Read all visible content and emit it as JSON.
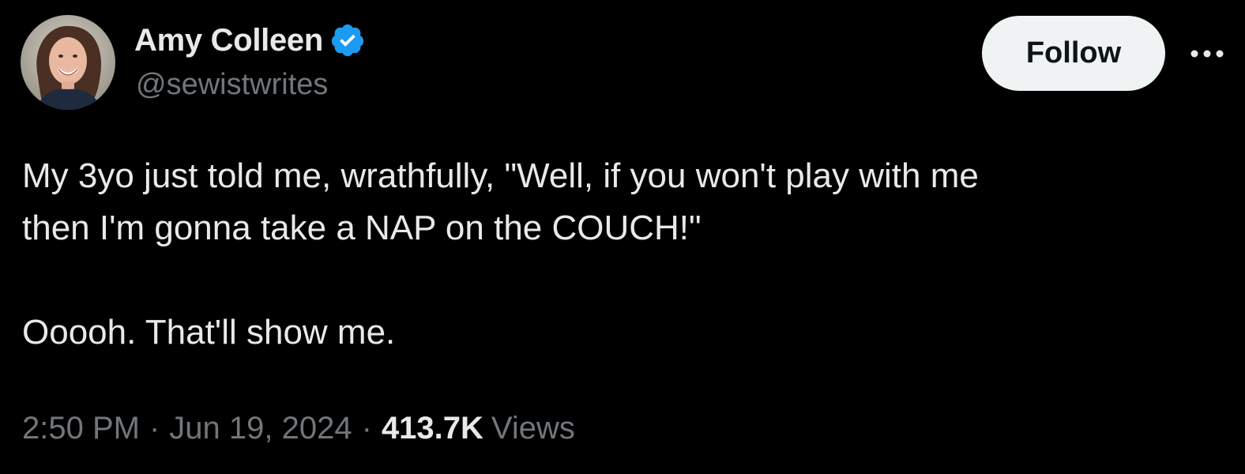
{
  "author": {
    "display_name": "Amy Colleen",
    "handle": "@sewistwrites",
    "verified": true,
    "verified_icon": "verified-badge-icon",
    "avatar": "avatar-photo"
  },
  "actions": {
    "follow_label": "Follow",
    "more_icon": "more-horizontal-icon"
  },
  "tweet": {
    "paragraphs": [
      "My 3yo just told me, wrathfully, \"Well, if you won't play with me\nthen I'm gonna take a NAP on the COUCH!\"",
      "Ooooh. That'll show me."
    ]
  },
  "meta": {
    "time": "2:50 PM",
    "separator": "·",
    "date": "Jun 19, 2024",
    "views_count": "413.7K",
    "views_label": "Views"
  },
  "colors": {
    "background": "#000000",
    "primary_text": "#e7e9ea",
    "secondary_text": "#71767b",
    "verified_blue": "#1d9bf0",
    "follow_button_bg": "#eff3f4",
    "follow_button_text": "#0f1419"
  }
}
